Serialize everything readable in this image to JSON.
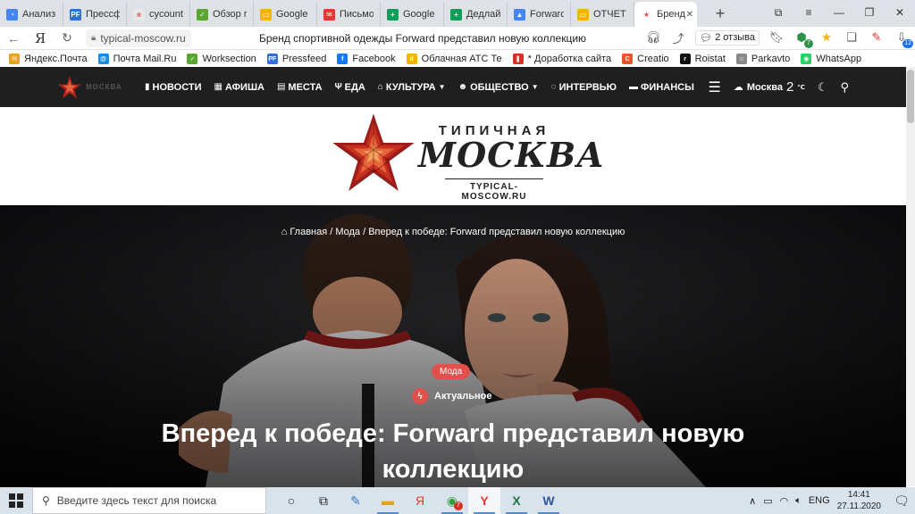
{
  "browser": {
    "tabs": [
      {
        "label": "Анализ с",
        "color": "#4285f4",
        "glyph": "◔"
      },
      {
        "label": "Прессфи",
        "color": "#2f6fd6",
        "glyph": "PF"
      },
      {
        "label": "cycounte",
        "color": "#e8e8e8",
        "glyph": "я"
      },
      {
        "label": "Обзор п",
        "color": "#5aa72f",
        "glyph": "✓"
      },
      {
        "label": "Google Г",
        "color": "#f4b400",
        "glyph": "▭"
      },
      {
        "label": "Письмо",
        "color": "#e33",
        "glyph": "✉"
      },
      {
        "label": "Google Т",
        "color": "#0f9d58",
        "glyph": "+"
      },
      {
        "label": "Дедлайн",
        "color": "#0f9d58",
        "glyph": "+"
      },
      {
        "label": "Forward",
        "color": "#4285f4",
        "glyph": "▲"
      },
      {
        "label": "ОТЧЕТ Р",
        "color": "#f4b400",
        "glyph": "▭"
      },
      {
        "label": "Бренд",
        "color": "#ffffff",
        "glyph": "★",
        "active": true
      }
    ],
    "new_tab": "+",
    "url": "typical-moscow.ru",
    "page_title": "Бренд спортивной одежды Forward представил новую коллекцию",
    "reviews": "2 отзыва",
    "ext_badge_1": "7",
    "ext_badge_2": "12",
    "bookmarks": [
      {
        "label": "Яндекс.Почта",
        "color": "#e8a317",
        "glyph": "✉"
      },
      {
        "label": "Почта Mail.Ru",
        "color": "#168de2",
        "glyph": "@"
      },
      {
        "label": "Worksection",
        "color": "#5aa72f",
        "glyph": "✓"
      },
      {
        "label": "Pressfeed",
        "color": "#2f6fd6",
        "glyph": "PF"
      },
      {
        "label": "Facebook",
        "color": "#1877f2",
        "glyph": "f"
      },
      {
        "label": "Облачная АТС Те",
        "color": "#f4b400",
        "glyph": "ıl"
      },
      {
        "label": "* Доработка сайта",
        "color": "#d93025",
        "glyph": "❚"
      },
      {
        "label": "Creatio",
        "color": "#e8552a",
        "glyph": "C"
      },
      {
        "label": "Roistat",
        "color": "#111",
        "glyph": "r"
      },
      {
        "label": "Parkavto",
        "color": "#888",
        "glyph": "☺"
      },
      {
        "label": "WhatsApp",
        "color": "#25d366",
        "glyph": "◉"
      }
    ]
  },
  "site": {
    "nav": [
      {
        "label": "НОВОСТИ",
        "icon": "▮",
        "caret": false
      },
      {
        "label": "АФИША",
        "icon": "▦",
        "caret": false
      },
      {
        "label": "МЕСТА",
        "icon": "▤",
        "caret": false
      },
      {
        "label": "ЕДА",
        "icon": "Ψ",
        "caret": false
      },
      {
        "label": "КУЛЬТУРА",
        "icon": "⌂",
        "caret": true
      },
      {
        "label": "ОБЩЕСТВО",
        "icon": "☻",
        "caret": true
      },
      {
        "label": "ИНТЕРВЬЮ",
        "icon": "◌",
        "caret": false
      },
      {
        "label": "ФИНАНСЫ",
        "icon": "▬",
        "caret": false
      }
    ],
    "weather_city": "Москва",
    "weather_temp": "2",
    "weather_unit": "℃",
    "brand_top": "ТИПИЧНАЯ",
    "brand_main": "МОСКВА",
    "brand_url": "TYPICAL-MOSCOW.RU"
  },
  "article": {
    "breadcrumb": "Главная / Мода / Вперед к победе: Forward представил новую коллекцию",
    "category": "Мода",
    "trending": "Актуальное",
    "headline": "Вперед к победе: Forward представил новую коллекцию"
  },
  "taskbar": {
    "search_placeholder": "Введите здесь текст для поиска",
    "badge": "7",
    "lang": "ENG",
    "time": "14:41",
    "date": "27.11.2020"
  },
  "colors": {
    "accent_red": "#e0504c",
    "nav_bg": "#1f1f1f"
  }
}
